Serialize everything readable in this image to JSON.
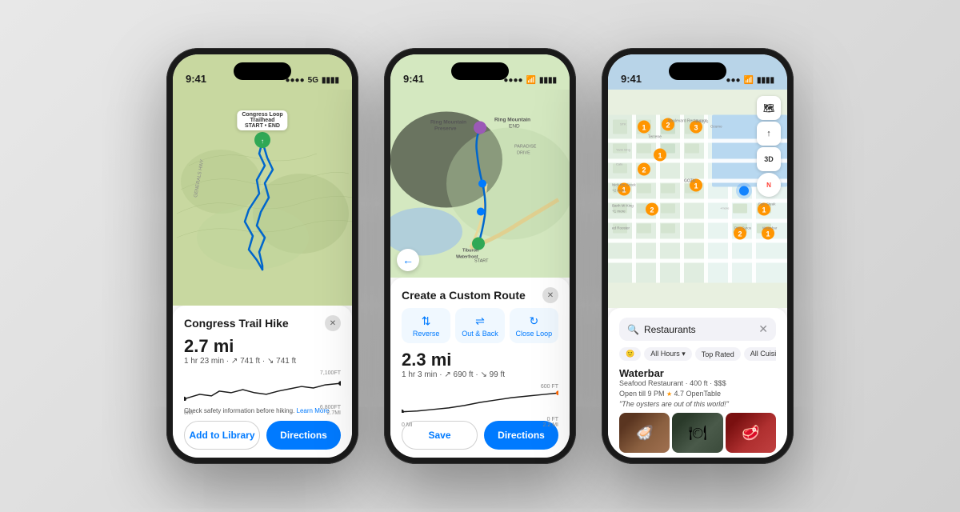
{
  "phone1": {
    "status": {
      "time": "9:41",
      "signal": "●●●●",
      "network": "5G",
      "battery": "▮▮▮▮"
    },
    "map": {
      "pin_label": "Congress Loop\nTrailhead",
      "pin_sublabel": "START • END"
    },
    "panel": {
      "title": "Congress Trail Hike",
      "distance": "2.7 mi",
      "time": "1 hr 23 min",
      "elevation_gain": "↗ 741 ft",
      "elevation_loss": "↘ 741 ft",
      "chart_left_label": "0MI",
      "chart_right_label": "2.7MI",
      "chart_top": "7,100FT",
      "chart_mid": "6,800FT",
      "safety_text": "Check safety information before hiking.",
      "safety_link": "Learn More",
      "btn_library": "Add to Library",
      "btn_directions": "Directions"
    }
  },
  "phone2": {
    "status": {
      "time": "9:41",
      "signal": "●●●●",
      "network": "",
      "wifi": "wifi",
      "battery": "▮▮▮▮"
    },
    "map": {
      "start_label": "START",
      "end_label": "Ring Mountain\nEND",
      "preserve_label": "Ring Mountain\nPreserve",
      "area_label": "PARADISE\nDRIVE",
      "tiburon_label": "Tiburon\nWaterfront"
    },
    "panel": {
      "title": "Create a Custom Route",
      "distance": "2.3 mi",
      "time": "1 hr 3 min",
      "elevation_gain": "↗ 690 ft",
      "elevation_loss": "↘ 99 ft",
      "chart_left_label": "0 MI",
      "chart_right_label": "2.2 MI",
      "chart_top": "600 FT",
      "chart_bottom": "0 FT",
      "opt_reverse": "Reverse",
      "opt_out_back": "Out & Back",
      "opt_close_loop": "Close Loop",
      "btn_save": "Save",
      "btn_directions": "Directions"
    }
  },
  "phone3": {
    "status": {
      "time": "9:41",
      "signal": "●●●",
      "wifi": "wifi",
      "battery": "▮▮▮▮"
    },
    "map": {
      "labels": [
        "Terrene",
        "Boulevard\nRestaurant",
        "Perry's",
        "Ozumo",
        "Nick the Greek\n+2 more",
        "GOZU",
        "Banh Mi King\n+1 more",
        "Epic Steak",
        "Waterbar",
        "Pita Gyros",
        "ed Rooster"
      ],
      "numbers": [
        "1",
        "2",
        "3",
        "1",
        "2",
        "1",
        "2",
        "1",
        "1",
        "1",
        "2"
      ]
    },
    "controls": {
      "map_icon": "🗺",
      "location_icon": "⬆",
      "three_d": "3D",
      "north": "N"
    },
    "panel": {
      "search_placeholder": "Restaurants",
      "filter_hours": "All Hours ▾",
      "filter_rating": "Top Rated",
      "filter_cuisines": "All Cuisines ▾",
      "restaurant_name": "Waterbar",
      "restaurant_type": "Seafood Restaurant",
      "restaurant_distance": "400 ft",
      "restaurant_price": "$$$",
      "restaurant_hours": "Open till 9 PM",
      "restaurant_rating": "4.7",
      "restaurant_platform": "OpenTable",
      "restaurant_quote": "\"The oysters are out of this world!\""
    }
  }
}
